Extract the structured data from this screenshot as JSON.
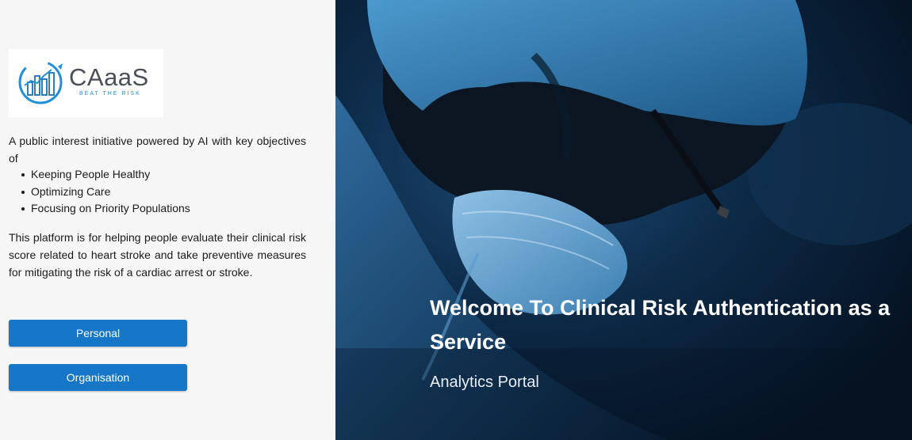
{
  "logo": {
    "name": "CAaaS",
    "tagline": "BEAT THE RISK",
    "brand_color": "#1f8fd6"
  },
  "intro": {
    "text": "A public interest initiative powered by AI with key objectives of",
    "objectives": [
      "Keeping People Healthy",
      "Optimizing Care",
      "Focusing on Priority Populations"
    ]
  },
  "description": "This platform is for helping people evaluate their clinical risk score related to heart stroke and take preventive measures for mitigating the risk of a cardiac arrest or stroke.",
  "buttons": {
    "personal": "Personal",
    "organisation": "Organisation",
    "color": "#1677c8"
  },
  "hero": {
    "title": "Welcome To Clinical Risk Authentication as a Service",
    "subtitle": "Analytics Portal"
  }
}
